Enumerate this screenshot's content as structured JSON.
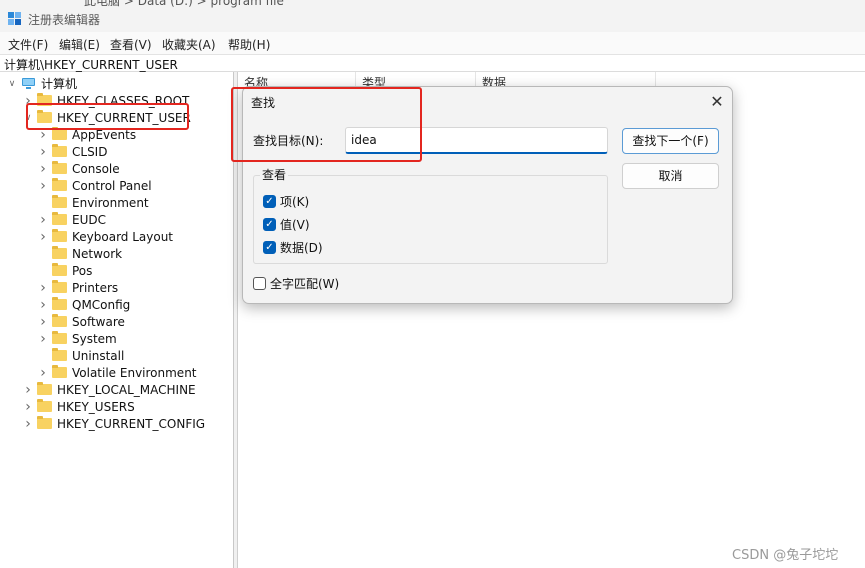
{
  "breadcrumb": [
    "此电脑",
    "Data (D:)",
    "program file"
  ],
  "window": {
    "title": "注册表编辑器"
  },
  "menu": [
    "文件(F)",
    "编辑(E)",
    "查看(V)",
    "收藏夹(A)",
    "帮助(H)"
  ],
  "address": "计算机\\HKEY_CURRENT_USER",
  "tree": {
    "root": "计算机",
    "items": [
      {
        "label": "HKEY_CLASSES_ROOT",
        "level": 1,
        "expander": "collapsed"
      },
      {
        "label": "HKEY_CURRENT_USER",
        "level": 1,
        "expander": "expanded"
      },
      {
        "label": "AppEvents",
        "level": 2,
        "expander": "collapsed"
      },
      {
        "label": "CLSID",
        "level": 2,
        "expander": "collapsed"
      },
      {
        "label": "Console",
        "level": 2,
        "expander": "collapsed"
      },
      {
        "label": "Control Panel",
        "level": 2,
        "expander": "collapsed"
      },
      {
        "label": "Environment",
        "level": 2,
        "expander": "none"
      },
      {
        "label": "EUDC",
        "level": 2,
        "expander": "collapsed"
      },
      {
        "label": "Keyboard Layout",
        "level": 2,
        "expander": "collapsed"
      },
      {
        "label": "Network",
        "level": 2,
        "expander": "none"
      },
      {
        "label": "Pos",
        "level": 2,
        "expander": "none"
      },
      {
        "label": "Printers",
        "level": 2,
        "expander": "collapsed"
      },
      {
        "label": "QMConfig",
        "level": 2,
        "expander": "collapsed"
      },
      {
        "label": "Software",
        "level": 2,
        "expander": "collapsed"
      },
      {
        "label": "System",
        "level": 2,
        "expander": "collapsed"
      },
      {
        "label": "Uninstall",
        "level": 2,
        "expander": "none"
      },
      {
        "label": "Volatile Environment",
        "level": 2,
        "expander": "collapsed"
      },
      {
        "label": "HKEY_LOCAL_MACHINE",
        "level": 1,
        "expander": "collapsed"
      },
      {
        "label": "HKEY_USERS",
        "level": 1,
        "expander": "collapsed"
      },
      {
        "label": "HKEY_CURRENT_CONFIG",
        "level": 1,
        "expander": "collapsed"
      }
    ]
  },
  "list": {
    "columns": [
      "名称",
      "类型",
      "数据"
    ]
  },
  "dialog": {
    "title": "查找",
    "find_label": "查找目标(N):",
    "find_value": "idea",
    "find_next": "查找下一个(F)",
    "cancel": "取消",
    "look_at_title": "查看",
    "options": [
      {
        "label": "项(K)",
        "checked": true
      },
      {
        "label": "值(V)",
        "checked": true
      },
      {
        "label": "数据(D)",
        "checked": true
      }
    ],
    "whole_string": {
      "label": "全字匹配(W)",
      "checked": false
    }
  },
  "watermark": "CSDN @兔子坨坨",
  "colors": {
    "highlight": "#e3261f",
    "accent": "#005fb8",
    "folder": "#f8d261"
  },
  "icons": {
    "close": "close-icon",
    "folder": "folder-icon",
    "computer": "computer-icon",
    "app": "regedit-icon"
  }
}
